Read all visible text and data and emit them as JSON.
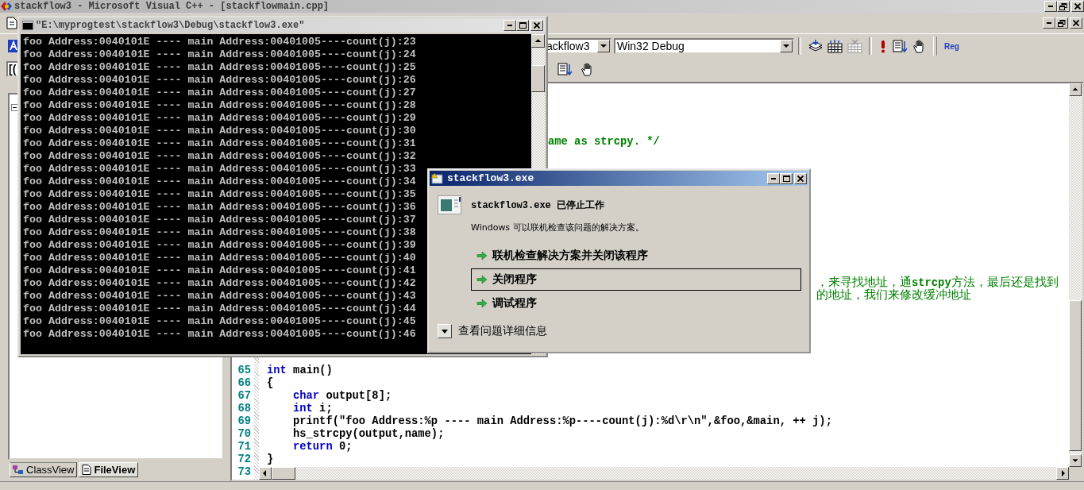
{
  "ide": {
    "title": "stackflow3 - Microsoft Visual C++ - [stackflowmain.cpp]",
    "toolbar": {
      "project": "ackflow3",
      "configuration": "Win32 Debug",
      "reg_button": "Reg"
    },
    "class_combo": "[(",
    "workspace_tabs": [
      {
        "label": "ClassView",
        "selected": false
      },
      {
        "label": "FileView",
        "selected": true
      }
    ],
    "editor": {
      "comment_fragment": "ame as strcpy. */",
      "comment_lines": [
        "，来寻找地址，通**strcpy**方法，最后还是找到",
        "的地址，我们来修改缓冲地址"
      ],
      "lines": [
        {
          "number": "65",
          "segments": [
            {
              "kind": "keyword",
              "text": "int"
            },
            {
              "kind": "plain",
              "text": " main()"
            }
          ]
        },
        {
          "number": "66",
          "segments": [
            {
              "kind": "plain",
              "text": "{"
            }
          ]
        },
        {
          "number": "67",
          "indented": true,
          "segments": [
            {
              "kind": "keyword",
              "text": "char"
            },
            {
              "kind": "plain",
              "text": " output[8];"
            }
          ]
        },
        {
          "number": "68",
          "indented": true,
          "segments": [
            {
              "kind": "keyword",
              "text": "int"
            },
            {
              "kind": "plain",
              "text": " i;"
            }
          ]
        },
        {
          "number": "69",
          "indented": true,
          "segments": [
            {
              "kind": "plain",
              "text": "printf(\"foo Address:%p ---- main Address:%p----count(j):%d\\r\\n\",&foo,&main, ++ j);"
            }
          ]
        },
        {
          "number": "70",
          "indented": true,
          "segments": [
            {
              "kind": "plain",
              "text": "hs_strcpy(output,name);"
            }
          ]
        },
        {
          "number": "71",
          "indented": true,
          "segments": [
            {
              "kind": "keyword",
              "text": "return"
            },
            {
              "kind": "plain",
              "text": " 0;"
            }
          ]
        },
        {
          "number": "72",
          "segments": [
            {
              "kind": "plain",
              "text": "}"
            }
          ]
        },
        {
          "number": "73"
        }
      ]
    }
  },
  "console": {
    "title": "\"E:\\myprogtest\\stackflow3\\Debug\\stackflow3.exe\"",
    "lines": [
      "foo Address:0040101E ---- main Address:00401005----count(j):23",
      "foo Address:0040101E ---- main Address:00401005----count(j):24",
      "foo Address:0040101E ---- main Address:00401005----count(j):25",
      "foo Address:0040101E ---- main Address:00401005----count(j):26",
      "foo Address:0040101E ---- main Address:00401005----count(j):27",
      "foo Address:0040101E ---- main Address:00401005----count(j):28",
      "foo Address:0040101E ---- main Address:00401005----count(j):29",
      "foo Address:0040101E ---- main Address:00401005----count(j):30",
      "foo Address:0040101E ---- main Address:00401005----count(j):31",
      "foo Address:0040101E ---- main Address:00401005----count(j):32",
      "foo Address:0040101E ---- main Address:00401005----count(j):33",
      "foo Address:0040101E ---- main Address:00401005----count(j):34",
      "foo Address:0040101E ---- main Address:00401005----count(j):35",
      "foo Address:0040101E ---- main Address:00401005----count(j):36",
      "foo Address:0040101E ---- main Address:00401005----count(j):37",
      "foo Address:0040101E ---- main Address:00401005----count(j):38",
      "foo Address:0040101E ---- main Address:00401005----count(j):39",
      "foo Address:0040101E ---- main Address:00401005----count(j):40",
      "foo Address:0040101E ---- main Address:00401005----count(j):41",
      "foo Address:0040101E ---- main Address:00401005----count(j):42",
      "foo Address:0040101E ---- main Address:00401005----count(j):43",
      "foo Address:0040101E ---- main Address:00401005----count(j):44",
      "foo Address:0040101E ---- main Address:00401005----count(j):45",
      "foo Address:0040101E ---- main Address:00401005----count(j):46"
    ]
  },
  "dialog": {
    "title": "stackflow3.exe",
    "heading": "stackflow3.exe 已停止工作",
    "message": "Windows 可以联机检查该问题的解决方案。",
    "options": [
      {
        "label": "联机检查解决方案并关闭该程序",
        "selected": false
      },
      {
        "label": "关闭程序",
        "selected": true
      },
      {
        "label": "调试程序",
        "selected": false
      }
    ],
    "details": "查看问题详细信息"
  }
}
